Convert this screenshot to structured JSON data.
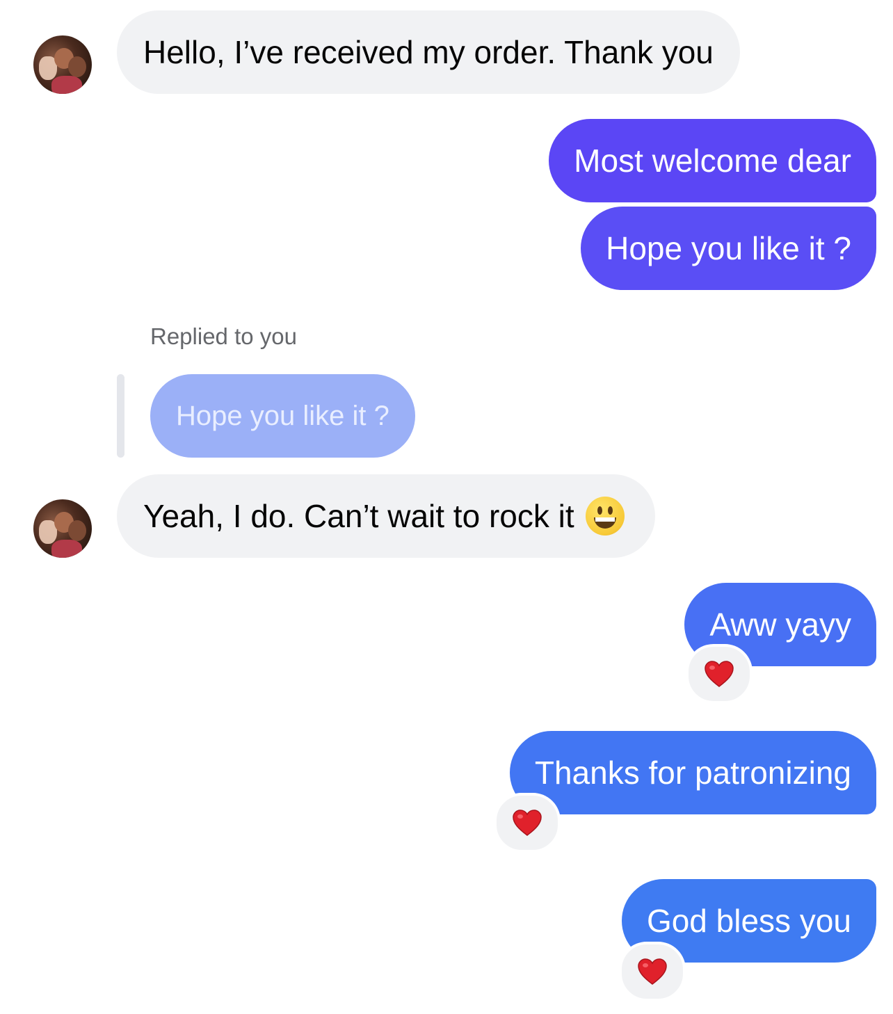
{
  "conversation": {
    "messages": [
      {
        "sender": "contact",
        "text": "Hello, I’ve received my order. Thank you"
      },
      {
        "sender": "me",
        "text": "Most welcome dear"
      },
      {
        "sender": "me",
        "text": "Hope you like it ?"
      },
      {
        "sender": "contact",
        "reply_label": "Replied to you",
        "quoted_text": "Hope you like it ?",
        "text": "Yeah, I do. Can’t wait to rock it",
        "emoji": "grinning-face"
      },
      {
        "sender": "me",
        "text": "Aww yayy",
        "reaction": "red-heart"
      },
      {
        "sender": "me",
        "text": "Thanks for patronizing",
        "reaction": "red-heart"
      },
      {
        "sender": "me",
        "text": "God bless you",
        "reaction": "red-heart"
      }
    ]
  },
  "colors": {
    "incoming_bubble": "#f1f2f4",
    "outgoing_gradient": [
      "#5b45f5",
      "#3f7bf2"
    ],
    "quoted_bubble": "#9bb0f7",
    "reaction_bg": "#f1f2f4",
    "heart": "#e0212b"
  }
}
